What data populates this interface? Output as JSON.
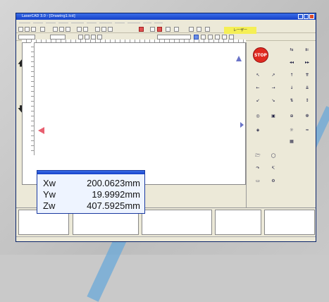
{
  "window": {
    "title": "LaserCAD 3.0 - [Drawing1.lcd]"
  },
  "toolbar": {
    "highlight_label": "レーザー"
  },
  "controls": {
    "stop_label": "STOP"
  },
  "coord_display": {
    "rows": [
      {
        "label": "Xw",
        "value": "200.0623mm"
      },
      {
        "label": "Yw",
        "value": "19.9992mm"
      },
      {
        "label": "Zw",
        "value": "407.5925mm"
      }
    ]
  },
  "colors": {
    "stop": "#e02a20",
    "ruler_marker": "#e02020",
    "titlebar": "#1541c8",
    "highlight_box": "#f5ef55"
  }
}
